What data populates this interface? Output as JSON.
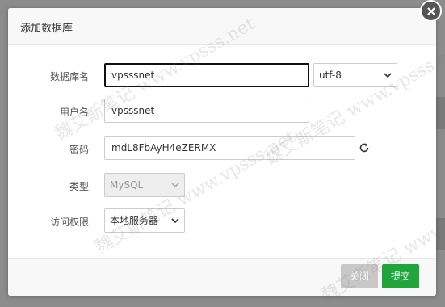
{
  "dialog": {
    "title": "添加数据库",
    "fields": {
      "db_name": {
        "label": "数据库名",
        "value": "vpsssnet",
        "encoding": "utf-8"
      },
      "username": {
        "label": "用户名",
        "value": "vpsssnet"
      },
      "password": {
        "label": "密码",
        "value": "mdL8FbAyH4eZERMX"
      },
      "type": {
        "label": "类型",
        "value": "MySQL"
      },
      "access": {
        "label": "访问权限",
        "value": "本地服务器"
      }
    },
    "buttons": {
      "close": "关闭",
      "submit": "提交"
    }
  },
  "watermark": "魏艾斯笔记 www.vpsss.net"
}
